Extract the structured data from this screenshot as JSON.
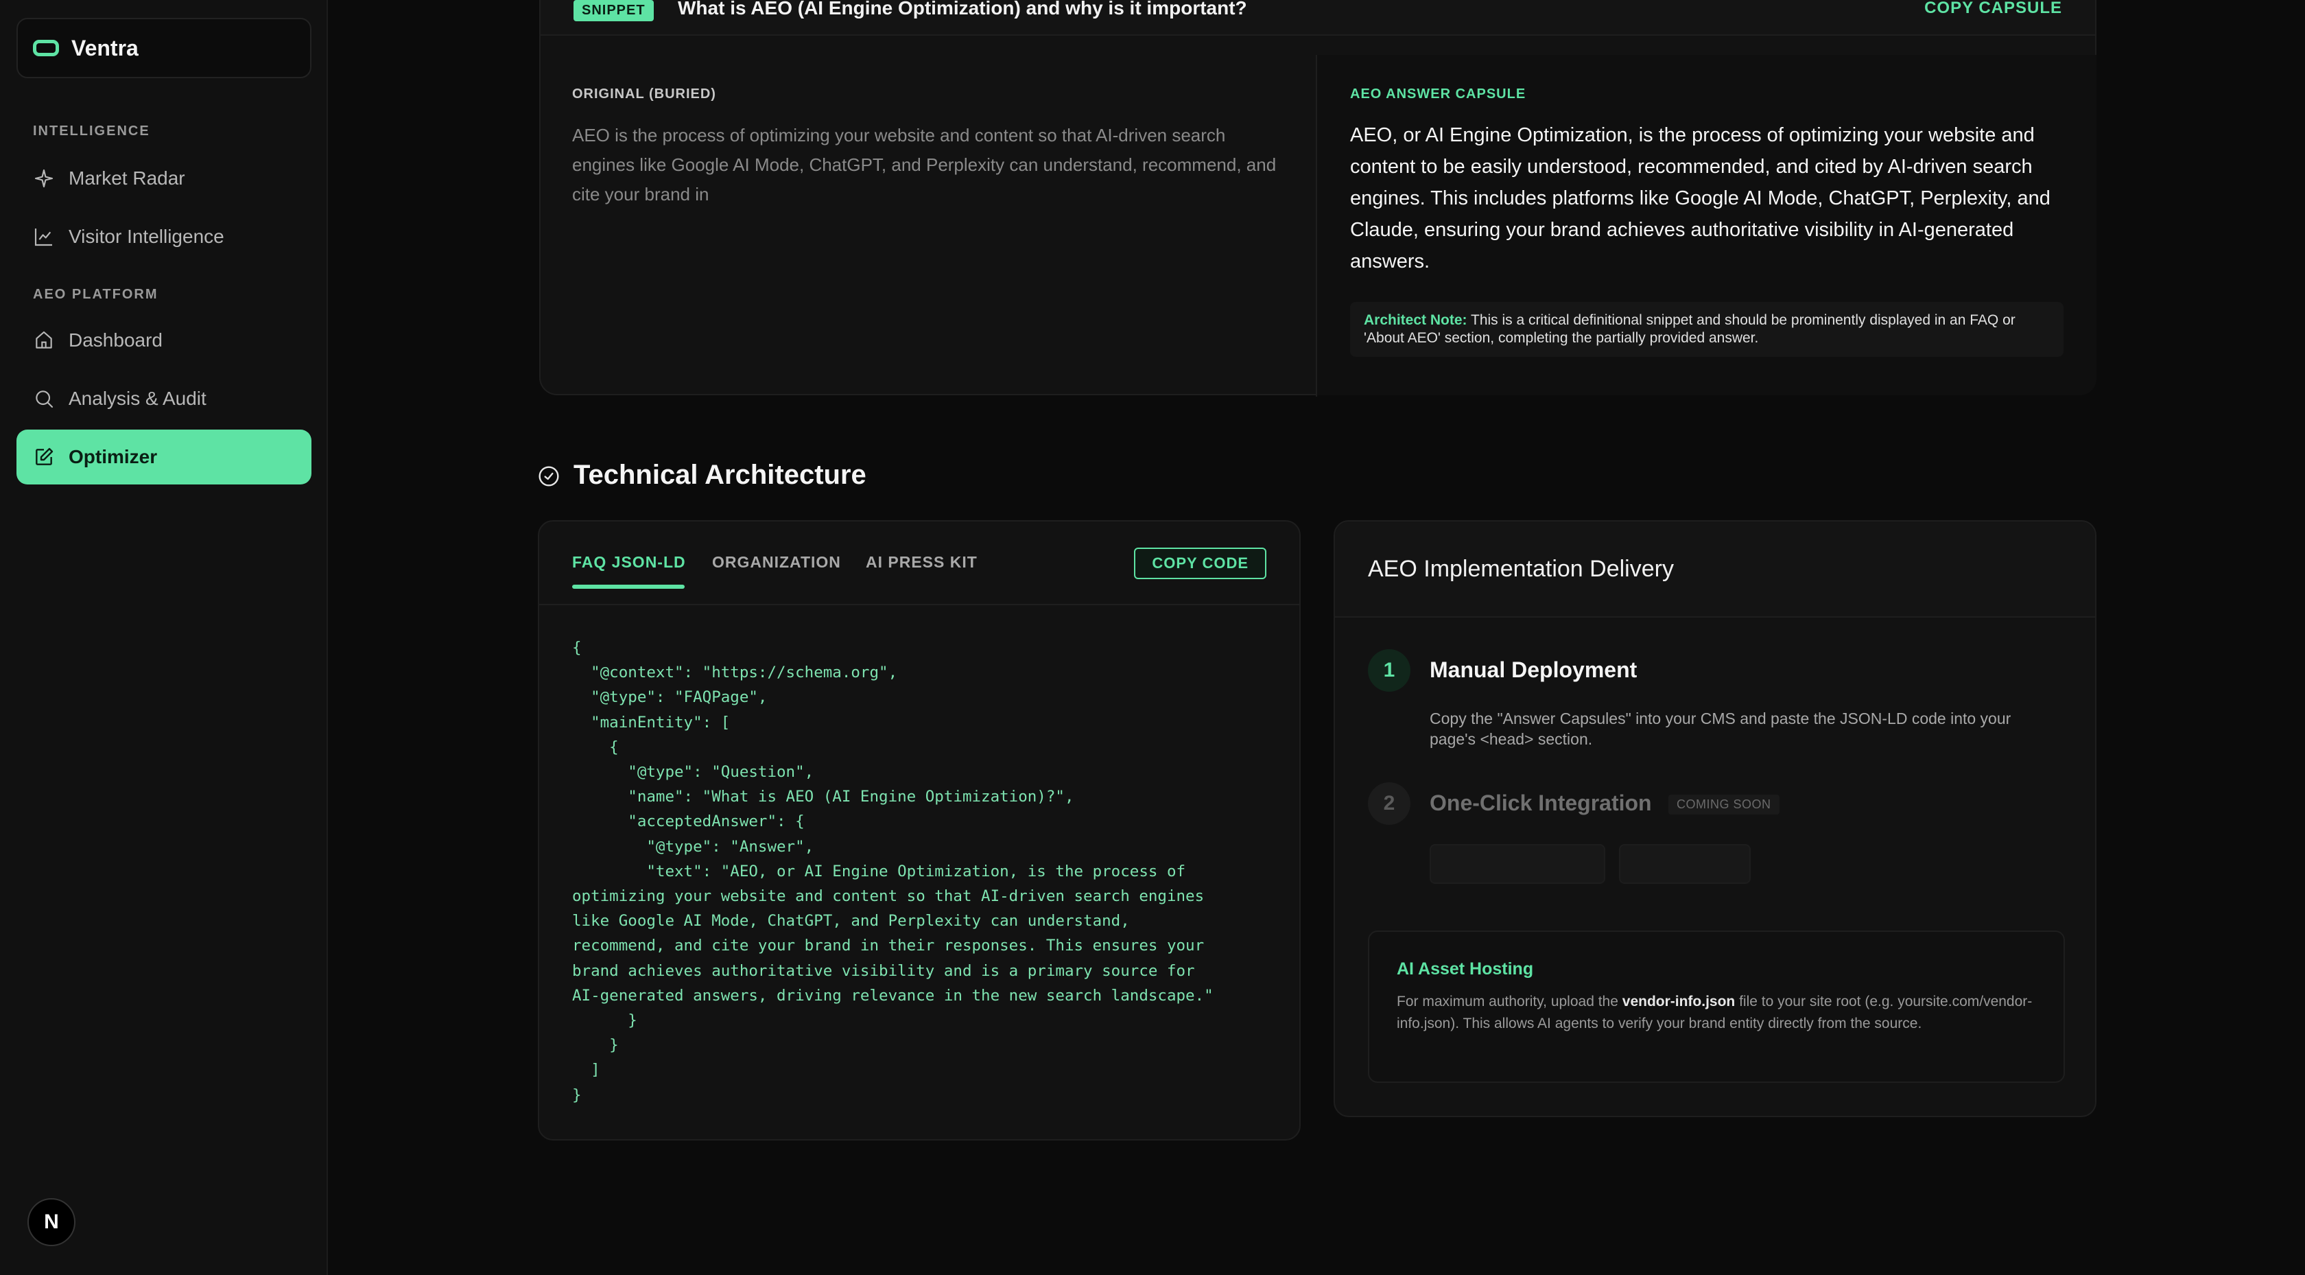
{
  "sidebar": {
    "brand": "Ventra",
    "sections": [
      {
        "title": "INTELLIGENCE",
        "items": [
          {
            "label": "Market Radar",
            "icon": "sparkle-icon"
          },
          {
            "label": "Visitor Intelligence",
            "icon": "line-chart-icon"
          }
        ]
      },
      {
        "title": "AEO PLATFORM",
        "items": [
          {
            "label": "Dashboard",
            "icon": "home-icon"
          },
          {
            "label": "Analysis & Audit",
            "icon": "search-icon"
          },
          {
            "label": "Optimizer",
            "icon": "edit-icon",
            "active": true
          }
        ]
      }
    ],
    "bottom_badge": "N"
  },
  "snippet": {
    "badge": "SNIPPET",
    "question": "What is AEO (AI Engine Optimization) and why is it important?",
    "copy_label": "COPY CAPSULE",
    "original_label": "ORIGINAL (BURIED)",
    "original_text": "AEO is the process of optimizing your website and content so that AI-driven search engines like Google AI Mode, ChatGPT, and Perplexity can understand, recommend, and cite your brand in",
    "capsule_label": "AEO ANSWER CAPSULE",
    "capsule_text": "AEO, or AI Engine Optimization, is the process of optimizing your website and content to be easily understood, recommended, and cited by AI-driven search engines. This includes platforms like Google AI Mode, ChatGPT, Perplexity, and Claude, ensuring your brand achieves authoritative visibility in AI-generated answers.",
    "note_label": "Architect Note:",
    "note_text": "This is a critical definitional snippet and should be prominently displayed in an FAQ or 'About AEO' section, completing the partially provided answer."
  },
  "architecture": {
    "title": "Technical Architecture",
    "tabs": [
      "FAQ JSON-LD",
      "ORGANIZATION",
      "AI PRESS KIT"
    ],
    "active_tab": "FAQ JSON-LD",
    "copy_code_label": "COPY CODE",
    "code": "{\n  \"@context\": \"https://schema.org\",\n  \"@type\": \"FAQPage\",\n  \"mainEntity\": [\n    {\n      \"@type\": \"Question\",\n      \"name\": \"What is AEO (AI Engine Optimization)?\",\n      \"acceptedAnswer\": {\n        \"@type\": \"Answer\",\n        \"text\": \"AEO, or AI Engine Optimization, is the process of\noptimizing your website and content so that AI-driven search engines\nlike Google AI Mode, ChatGPT, and Perplexity can understand,\nrecommend, and cite your brand in their responses. This ensures your\nbrand achieves authoritative visibility and is a primary source for\nAI-generated answers, driving relevance in the new search landscape.\"\n      }\n    }\n  ]\n}"
  },
  "delivery": {
    "title": "AEO Implementation Delivery",
    "step1_num": "1",
    "step1_title": "Manual Deployment",
    "step1_desc": "Copy the \"Answer Capsules\" into your CMS and paste the JSON-LD code into your page's <head> section.",
    "step2_num": "2",
    "step2_title": "One-Click Integration",
    "step2_badge": "COMING SOON",
    "hosting_title": "AI Asset Hosting",
    "hosting_pre": "For maximum authority, upload the ",
    "hosting_file": "vendor-info.json",
    "hosting_post": " file to your site root (e.g. yoursite.com/vendor-info.json). This allows AI agents to verify your brand entity directly from the source."
  },
  "colors": {
    "accent": "#5ee3a4",
    "background": "#0b0b0b",
    "sidebar": "#111111"
  }
}
